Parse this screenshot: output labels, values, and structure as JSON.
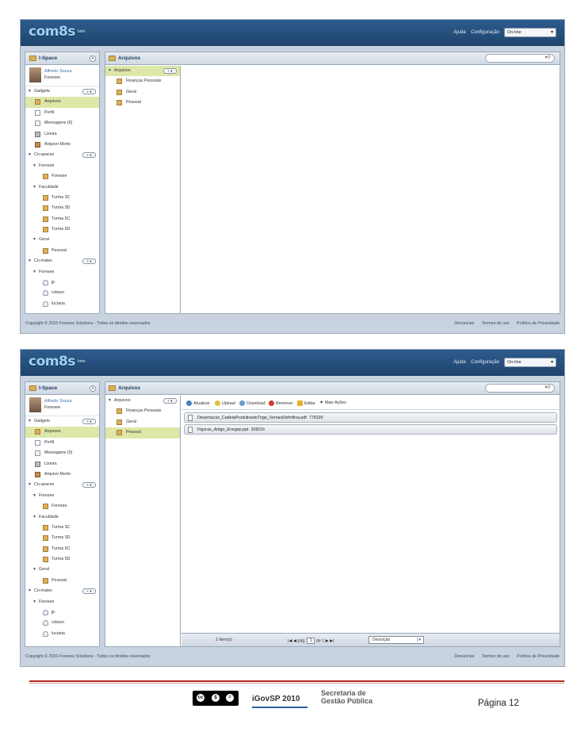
{
  "app": {
    "logo": "com8s",
    "beta": "beta",
    "top_links": [
      "Ajuda",
      "Configuração"
    ],
    "status": "On-line"
  },
  "sidebar": {
    "title": "I-Space",
    "user_name": "Alfredo Souza",
    "user_org": "Foresee",
    "add_label": "+ ▾",
    "gadgets_label": "Gadgets",
    "gadgets": [
      "Arquivos",
      "Perfil",
      "Mensagens (0)",
      "Lixeira",
      "Arquivo Morto"
    ],
    "cospaces_label": "Co-spaces",
    "foresee_label": "Foresee",
    "foresee_item": "Foresee",
    "faculdade_label": "Faculdade",
    "turmas": [
      "Turma 3C",
      "Turma 3D",
      "Turma 5C",
      "Turma 5D"
    ],
    "geral_label": "Geral",
    "pessoal": "Pessoal",
    "comates_label": "Co-mates",
    "comates_group": "Foresee",
    "mates": [
      "jp",
      "robson",
      "luciana"
    ]
  },
  "main": {
    "title": "Arquivos",
    "tree_root": "Arquivos",
    "folders": [
      "Finanças Pessoais",
      "Geral",
      "Pessoal"
    ]
  },
  "toolbar": {
    "atualizar": "Atualizar",
    "upload": "Upload",
    "download": "Download",
    "remover": "Remover",
    "editar": "Editar",
    "mais_acoes": "Mais Ações"
  },
  "files": [
    {
      "name": "Dissertacao_CadeiaProdutivadoTrigo_VersaoDefinitiva.pdf",
      "size": "778195"
    },
    {
      "name": "Figuras_Artigo_Enegep.ppt",
      "size": "328216"
    }
  ],
  "pager": {
    "count": "2 Item(s)",
    "page_label": "pág:",
    "page": "1",
    "of": "de 1",
    "sort": "Descrição"
  },
  "footer": {
    "copyright": "Copyright © 2010 Foresee Solutions - Todos os direitos reservados",
    "links": [
      "Denúncias",
      "Termos de uso",
      "Política de Privacidade"
    ]
  },
  "document": {
    "cc": [
      "cc",
      "$",
      "="
    ],
    "igov": "iGovSP 2010",
    "secretaria_1": "Secretaria de",
    "secretaria_2": "Gestão Pública",
    "page": "Página 12"
  }
}
